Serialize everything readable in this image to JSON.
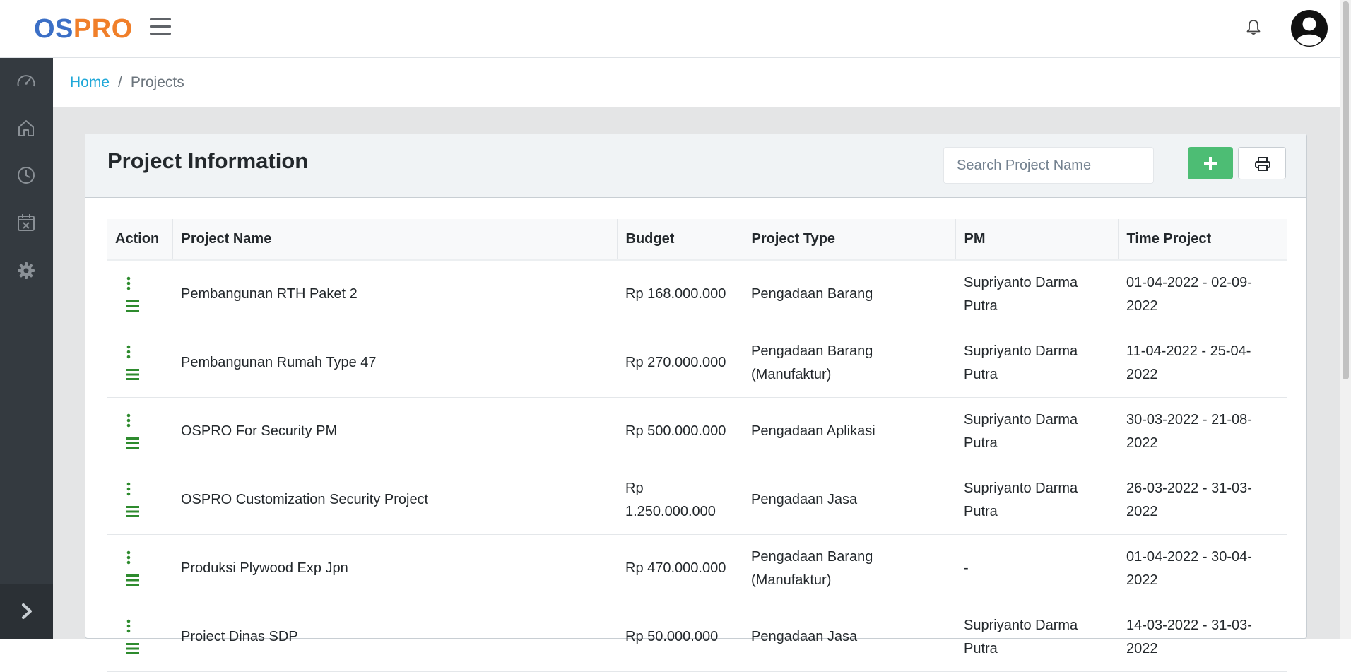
{
  "app": {
    "logo_part1": "OS",
    "logo_part2": "PRO"
  },
  "breadcrumb": {
    "home": "Home",
    "separator": "/",
    "current": "Projects"
  },
  "card": {
    "title": "Project Information",
    "search_placeholder": "Search Project Name"
  },
  "table": {
    "headers": [
      "Action",
      "Project Name",
      "Budget",
      "Project Type",
      "PM",
      "Time Project"
    ],
    "rows": [
      {
        "name": "Pembangunan RTH Paket 2",
        "budget": "Rp 168.000.000",
        "type": "Pengadaan Barang",
        "pm": "Supriyanto Darma Putra",
        "time": "01-04-2022 - 02-09-2022"
      },
      {
        "name": "Pembangunan Rumah Type 47",
        "budget": "Rp 270.000.000",
        "type": "Pengadaan Barang (Manufaktur)",
        "pm": "Supriyanto Darma Putra",
        "time": "11-04-2022 - 25-04-2022"
      },
      {
        "name": "OSPRO For Security PM",
        "budget": "Rp 500.000.000",
        "type": "Pengadaan Aplikasi",
        "pm": "Supriyanto Darma Putra",
        "time": "30-03-2022 - 21-08-2022"
      },
      {
        "name": "OSPRO Customization Security Project",
        "budget": "Rp 1.250.000.000",
        "type": "Pengadaan Jasa",
        "pm": "Supriyanto Darma Putra",
        "time": "26-03-2022 - 31-03-2022"
      },
      {
        "name": "Produksi Plywood Exp Jpn",
        "budget": "Rp 470.000.000",
        "type": "Pengadaan Barang (Manufaktur)",
        "pm": "-",
        "time": "01-04-2022 - 30-04-2022"
      },
      {
        "name": "Proiect Dinas SDP",
        "budget": "Rp 50.000.000",
        "type": "Pengadaan Jasa",
        "pm": "Supriyanto Darma Putra",
        "time": "14-03-2022 - 31-03-2022"
      }
    ]
  },
  "icons": {
    "brand_blue": "#3b6fc6",
    "brand_orange": "#f07f2a",
    "action_green": "#2e8b2e",
    "add_green": "#4dbd74",
    "sidebar_bg": "#343a40"
  }
}
